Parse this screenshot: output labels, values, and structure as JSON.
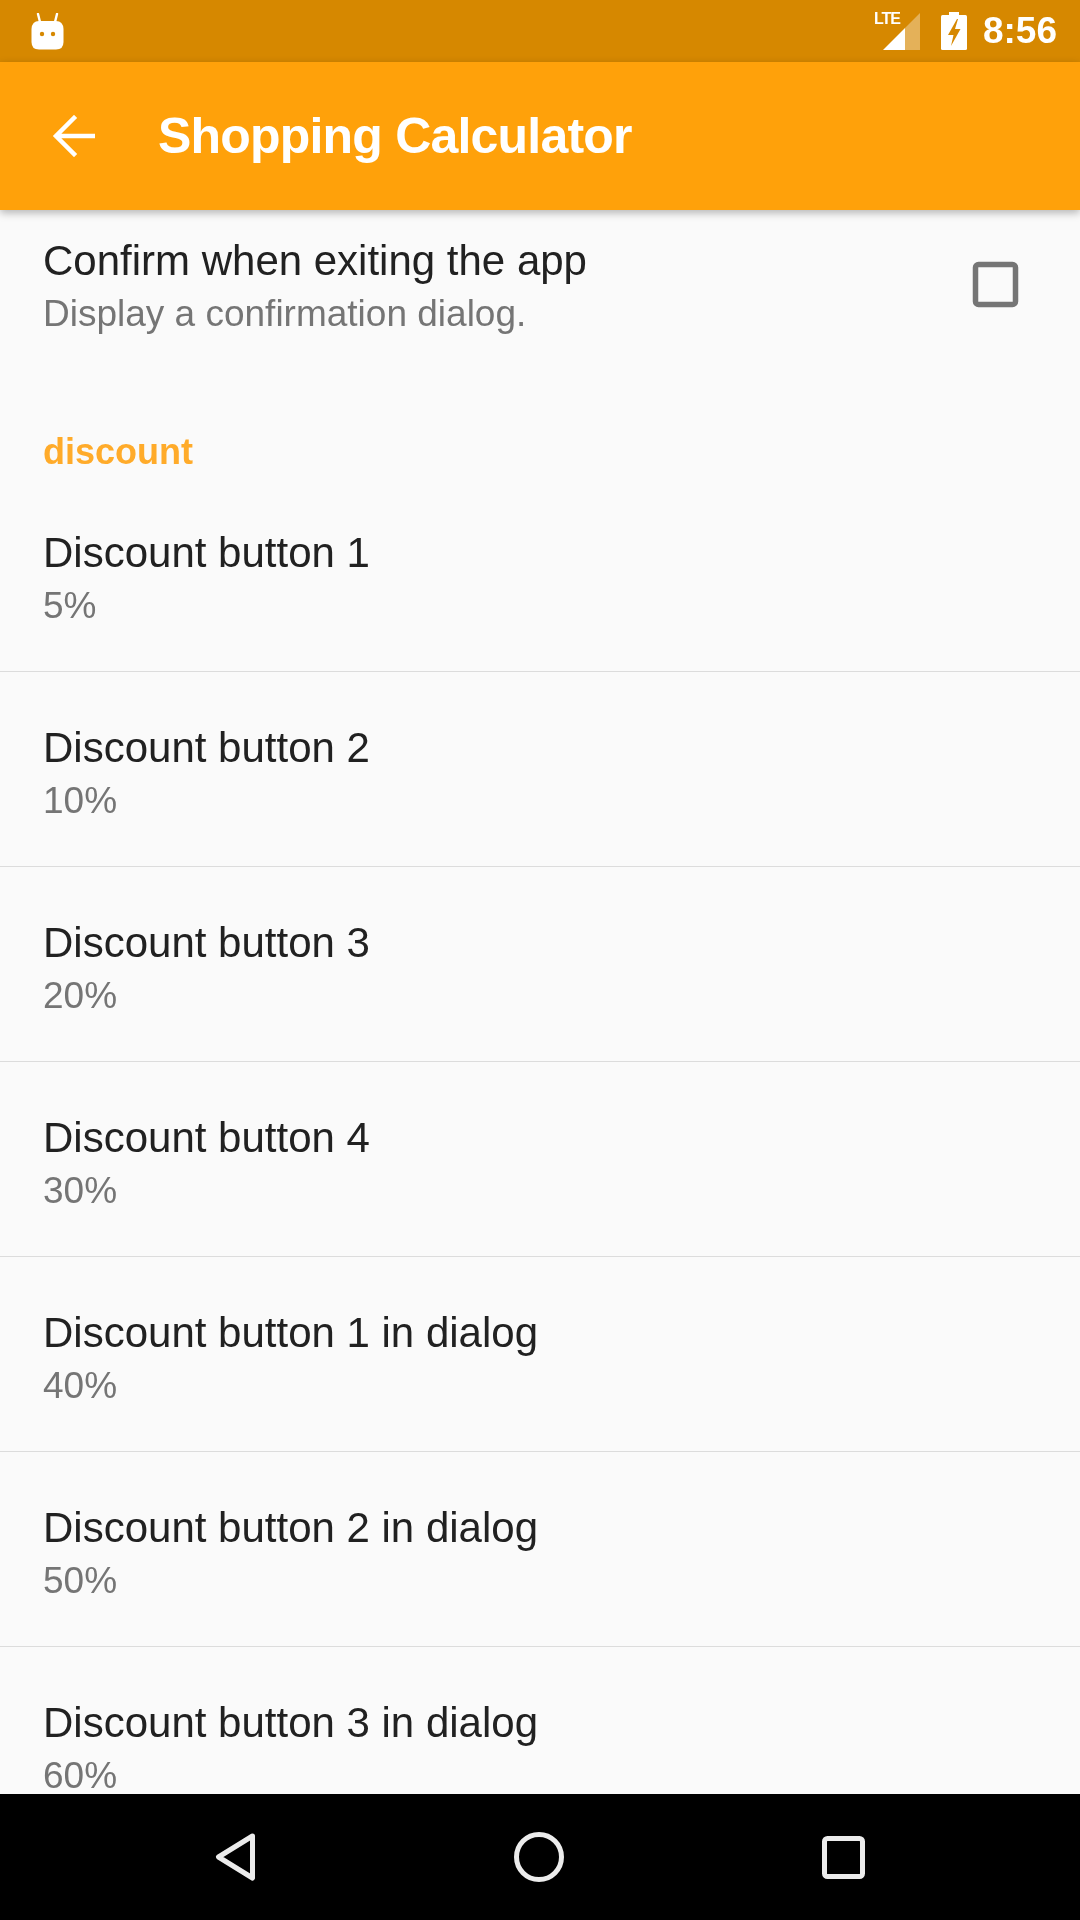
{
  "status_bar": {
    "network_type": "LTE",
    "time": "8:56"
  },
  "app_bar": {
    "title": "Shopping Calculator"
  },
  "preferences": [
    {
      "kind": "checkbox",
      "title": "Confirm when exiting the app",
      "summary": "Display a confirmation dialog.",
      "checked": false
    },
    {
      "kind": "category",
      "title": "discount"
    },
    {
      "kind": "item",
      "title": "Discount button 1",
      "summary": "5%"
    },
    {
      "kind": "item",
      "title": "Discount button 2",
      "summary": "10%"
    },
    {
      "kind": "item",
      "title": "Discount button 3",
      "summary": "20%"
    },
    {
      "kind": "item",
      "title": "Discount button 4",
      "summary": "30%"
    },
    {
      "kind": "item",
      "title": "Discount button 1 in dialog",
      "summary": "40%"
    },
    {
      "kind": "item",
      "title": "Discount button 2 in dialog",
      "summary": "50%"
    },
    {
      "kind": "item",
      "title": "Discount button 3 in dialog",
      "summary": "60%"
    }
  ]
}
